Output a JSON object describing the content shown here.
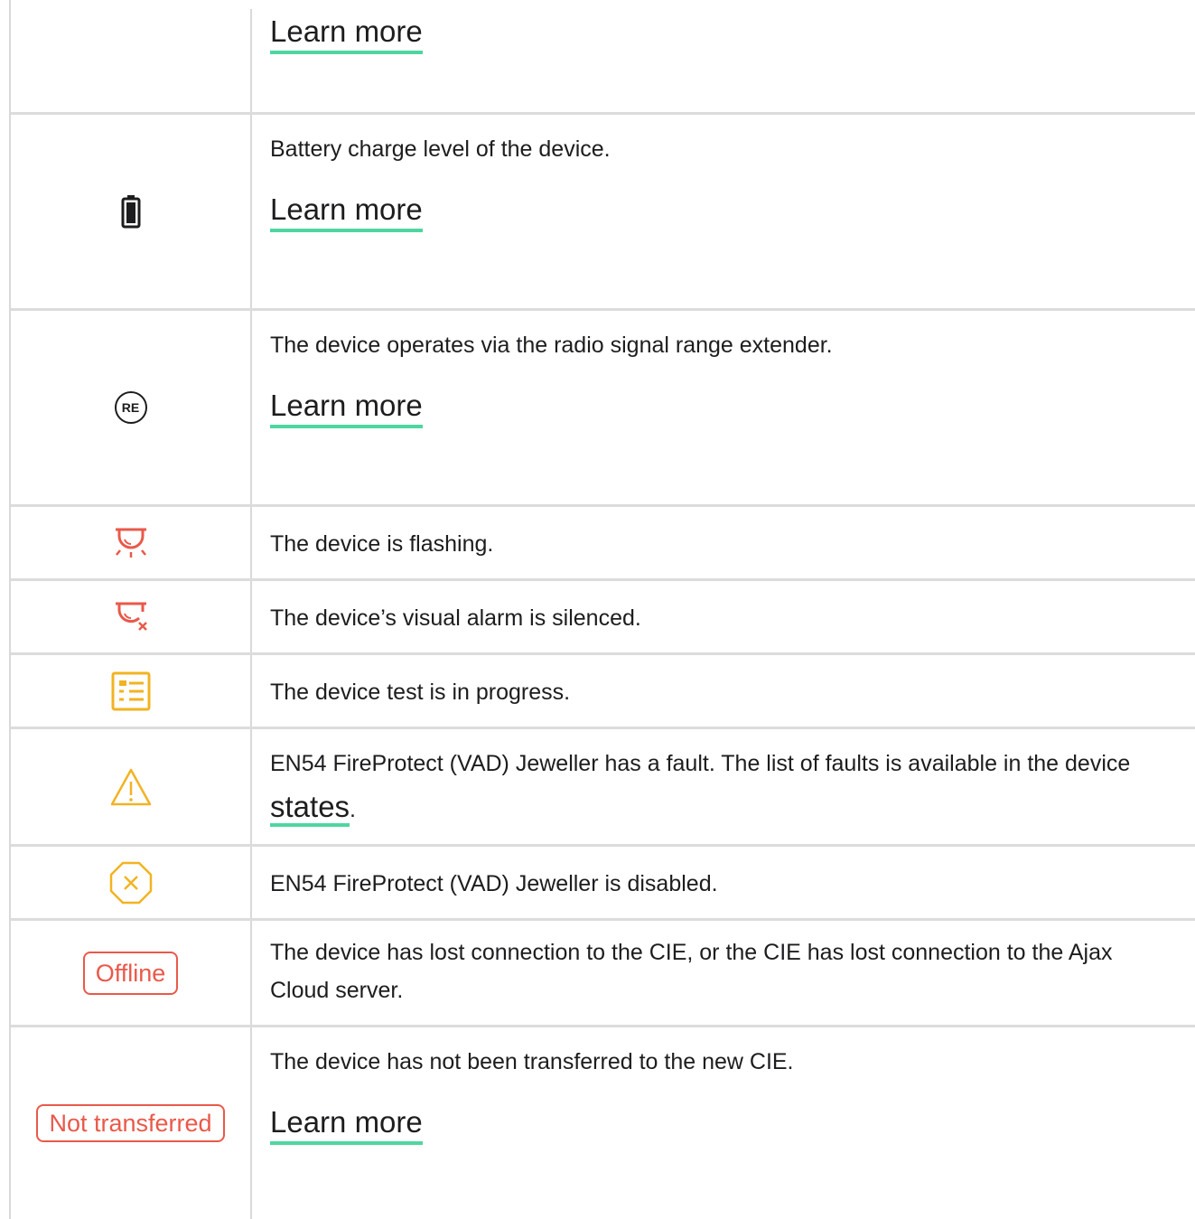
{
  "colors": {
    "accent_green": "#4fd6a0",
    "danger_red": "#e9594a",
    "warning_amber": "#f2b322",
    "text": "#1d1d1f"
  },
  "rows": [
    {
      "icon": "",
      "learn_more": "Learn more"
    },
    {
      "icon": "battery-icon",
      "text": "Battery charge level of the device.",
      "learn_more": "Learn more"
    },
    {
      "icon": "re-icon",
      "text": "The device operates via the radio signal range extender.",
      "learn_more": "Learn more"
    },
    {
      "icon": "siren-flashing-icon",
      "text": "The device is flashing."
    },
    {
      "icon": "siren-silenced-icon",
      "text": "The device’s visual alarm is silenced."
    },
    {
      "icon": "test-list-icon",
      "text": "The device test is in progress."
    },
    {
      "icon": "warning-triangle-icon",
      "text_before": "EN54 FireProtect (VAD) Jeweller has a fault. The list of faults is available in the device ",
      "link": "states",
      "text_after": "."
    },
    {
      "icon": "disabled-octagon-icon",
      "text": "EN54 FireProtect (VAD) Jeweller is disabled."
    },
    {
      "badge": "Offline",
      "text": "The device has lost connection to the CIE, or the CIE has lost connection to the Ajax Cloud server."
    },
    {
      "badge": "Not transferred",
      "text": "The device has not been transferred to the new CIE.",
      "learn_more": "Learn more"
    }
  ],
  "icon_glyphs": {
    "re": "RE",
    "cross": "×"
  }
}
